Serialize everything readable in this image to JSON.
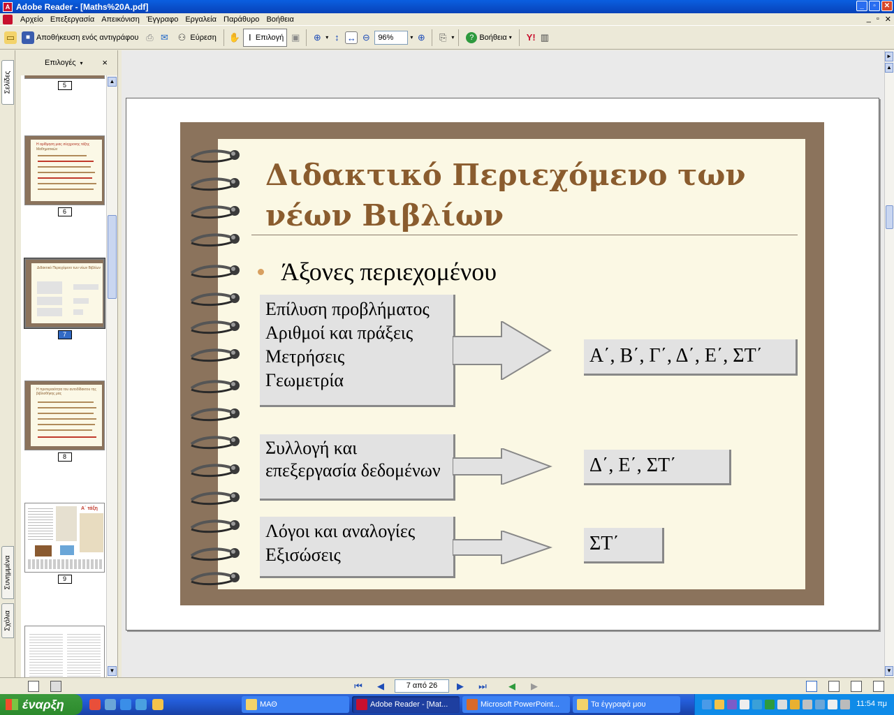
{
  "window": {
    "title": "Adobe Reader - [Maths%20A.pdf]",
    "app_icon": "adobe-reader-icon"
  },
  "menu": {
    "items": [
      "Αρχείο",
      "Επεξεργασία",
      "Απεικόνιση",
      "Έγγραφο",
      "Εργαλεία",
      "Παράθυρο",
      "Βοήθεια"
    ]
  },
  "toolbar": {
    "save_copy_label": "Αποθήκευση ενός αντιγράφου",
    "search_label": "Εύρεση",
    "select_label": "Επιλογή",
    "zoom_value": "96%",
    "help_label": "Βοήθεια",
    "yahoo_label": "Y!"
  },
  "side_tabs": {
    "pages": "Σελίδες",
    "bookmarks": "Συνημμένα",
    "comments": "Σχόλια"
  },
  "thumbnails": {
    "options_label": "Επιλογές",
    "close_symbol": "×",
    "pages": [
      {
        "num": "5",
        "selected": false
      },
      {
        "num": "6",
        "selected": false
      },
      {
        "num": "7",
        "selected": true
      },
      {
        "num": "8",
        "selected": false
      },
      {
        "num": "9",
        "selected": false
      }
    ],
    "page6_lines": [
      "Η αρίθμηση μιας σύγχρονης τάξης",
      "Μαθηματικών"
    ],
    "page7_title": "Διδακτικό Περιεχόμενο των νέων Βιβλίων",
    "page8_title": "Η προτεραιότητα του αυτοδίδακτου της βιβλιοθήκης μας",
    "page9_title": "Α΄ τάξη"
  },
  "slide": {
    "title": "Διδακτικό Περιεχόμενο των νέων Βιβλίων",
    "bullet": "Άξονες  περιεχομένου",
    "groups": [
      {
        "left_lines": [
          "Επίλυση προβλήματος",
          "Αριθμοί και πράξεις",
          "Μετρήσεις",
          "Γεωμετρία"
        ],
        "right": "Α΄, Β΄, Γ΄, Δ΄, Ε΄, ΣΤ΄"
      },
      {
        "left_lines": [
          "Συλλογή και",
          "επεξεργασία δεδομένων"
        ],
        "right": "Δ΄, Ε΄, ΣΤ΄"
      },
      {
        "left_lines": [
          "Λόγοι και αναλογίες",
          "Εξισώσεις"
        ],
        "right": "ΣΤ΄"
      }
    ],
    "colors": {
      "frame": "#8b735c",
      "paper": "#fbf8e4",
      "title": "#8a5c2e",
      "box": "#e2e2e2"
    }
  },
  "status": {
    "page_field": "7 από 26"
  },
  "taskbar": {
    "start_label": "έναρξη",
    "tasks": [
      "ΜΑΘ",
      "Adobe Reader - [Mat...",
      "Microsoft PowerPoint...",
      "Τα έγγραφά μου"
    ],
    "clock": "11:54 πμ"
  }
}
